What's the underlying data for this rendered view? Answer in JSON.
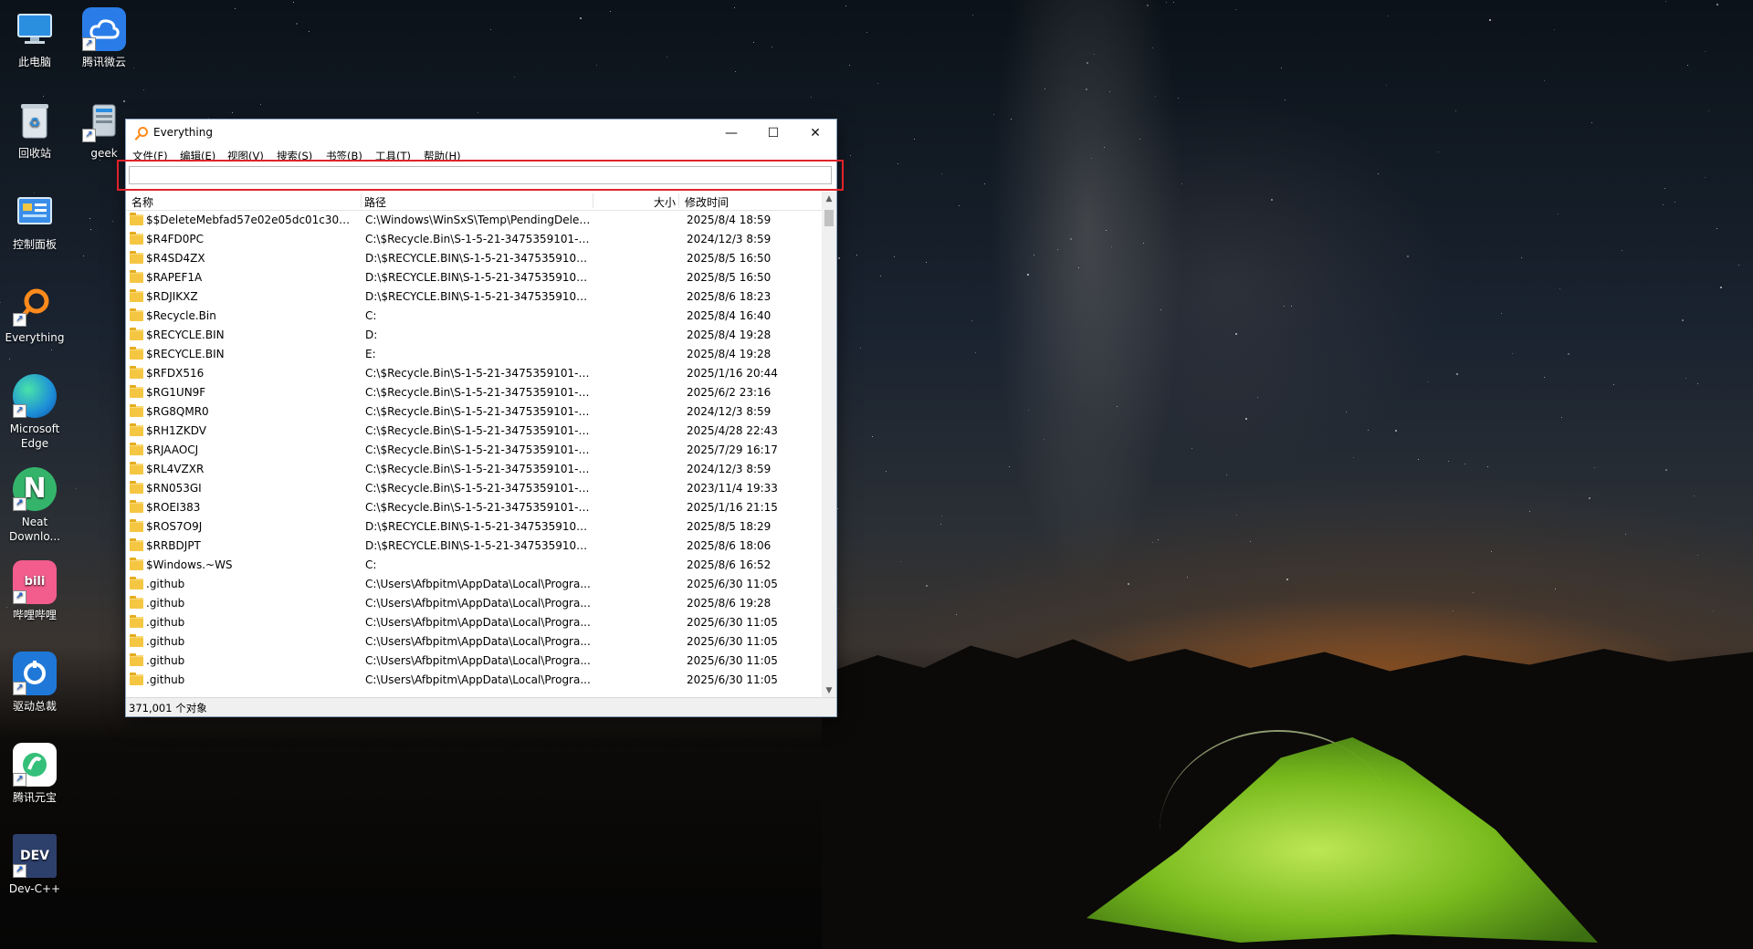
{
  "desktop": {
    "icons": [
      {
        "label": "此电脑",
        "icon": "computer-icon"
      },
      {
        "label": "腾讯微云",
        "icon": "cloud-icon"
      },
      {
        "label": "回收站",
        "icon": "recycle-bin-icon"
      },
      {
        "label": "geek",
        "icon": "geek-app-icon"
      },
      {
        "label": "控制面板",
        "icon": "control-panel-icon"
      },
      {
        "label": "Everything",
        "icon": "everything-icon"
      },
      {
        "label": "Microsoft Edge",
        "icon": "edge-icon"
      },
      {
        "label": "Neat Downlo...",
        "icon": "neat-download-icon"
      },
      {
        "label": "哔哩哔哩",
        "icon": "bilibili-icon"
      },
      {
        "label": "驱动总裁",
        "icon": "driver-icon"
      },
      {
        "label": "腾讯元宝",
        "icon": "yuanbao-icon"
      },
      {
        "label": "Dev-C++",
        "icon": "devcpp-icon"
      }
    ]
  },
  "window": {
    "title": "Everything",
    "controls": {
      "minimize": "—",
      "maximize": "☐",
      "close": "✕"
    },
    "menu": [
      "文件(F)",
      "编辑(E)",
      "视图(V)",
      "搜索(S)",
      "书签(B)",
      "工具(T)",
      "帮助(H)"
    ],
    "search": {
      "value": "",
      "placeholder": ""
    },
    "columns": {
      "name": "名称",
      "path": "路径",
      "size": "大小",
      "modified": "修改时间"
    },
    "rows": [
      {
        "name": "$$DeleteMebfad57e02e05dc01c30000...",
        "path": "C:\\Windows\\WinSxS\\Temp\\PendingDelet...",
        "modified": "2025/8/4 18:59"
      },
      {
        "name": "$R4FD0PC",
        "path": "C:\\$Recycle.Bin\\S-1-5-21-3475359101-10...",
        "modified": "2024/12/3 8:59"
      },
      {
        "name": "$R4SD4ZX",
        "path": "D:\\$RECYCLE.BIN\\S-1-5-21-3475359101-...",
        "modified": "2025/8/5 16:50"
      },
      {
        "name": "$RAPEF1A",
        "path": "D:\\$RECYCLE.BIN\\S-1-5-21-3475359101-...",
        "modified": "2025/8/5 16:50"
      },
      {
        "name": "$RDJIKXZ",
        "path": "D:\\$RECYCLE.BIN\\S-1-5-21-3475359101-...",
        "modified": "2025/8/6 18:23"
      },
      {
        "name": "$Recycle.Bin",
        "path": "C:",
        "modified": "2025/8/4 16:40"
      },
      {
        "name": "$RECYCLE.BIN",
        "path": "D:",
        "modified": "2025/8/4 19:28"
      },
      {
        "name": "$RECYCLE.BIN",
        "path": "E:",
        "modified": "2025/8/4 19:28"
      },
      {
        "name": "$RFDX516",
        "path": "C:\\$Recycle.Bin\\S-1-5-21-3475359101-10...",
        "modified": "2025/1/16 20:44"
      },
      {
        "name": "$RG1UN9F",
        "path": "C:\\$Recycle.Bin\\S-1-5-21-3475359101-10...",
        "modified": "2025/6/2 23:16"
      },
      {
        "name": "$RG8QMR0",
        "path": "C:\\$Recycle.Bin\\S-1-5-21-3475359101-10...",
        "modified": "2024/12/3 8:59"
      },
      {
        "name": "$RH1ZKDV",
        "path": "C:\\$Recycle.Bin\\S-1-5-21-3475359101-10...",
        "modified": "2025/4/28 22:43"
      },
      {
        "name": "$RJAAOCJ",
        "path": "C:\\$Recycle.Bin\\S-1-5-21-3475359101-10...",
        "modified": "2025/7/29 16:17"
      },
      {
        "name": "$RL4VZXR",
        "path": "C:\\$Recycle.Bin\\S-1-5-21-3475359101-10...",
        "modified": "2024/12/3 8:59"
      },
      {
        "name": "$RN053GI",
        "path": "C:\\$Recycle.Bin\\S-1-5-21-3475359101-10...",
        "modified": "2023/11/4 19:33"
      },
      {
        "name": "$ROEI383",
        "path": "C:\\$Recycle.Bin\\S-1-5-21-3475359101-10...",
        "modified": "2025/1/16 21:15"
      },
      {
        "name": "$ROS7O9J",
        "path": "D:\\$RECYCLE.BIN\\S-1-5-21-3475359101-...",
        "modified": "2025/8/5 18:29"
      },
      {
        "name": "$RRBDJPT",
        "path": "D:\\$RECYCLE.BIN\\S-1-5-21-3475359101-...",
        "modified": "2025/8/6 18:06"
      },
      {
        "name": "$Windows.~WS",
        "path": "C:",
        "modified": "2025/8/6 16:52"
      },
      {
        "name": ".github",
        "path": "C:\\Users\\Afbpitm\\AppData\\Local\\Progra...",
        "modified": "2025/6/30 11:05"
      },
      {
        "name": ".github",
        "path": "C:\\Users\\Afbpitm\\AppData\\Local\\Progra...",
        "modified": "2025/8/6 19:28"
      },
      {
        "name": ".github",
        "path": "C:\\Users\\Afbpitm\\AppData\\Local\\Progra...",
        "modified": "2025/6/30 11:05"
      },
      {
        "name": ".github",
        "path": "C:\\Users\\Afbpitm\\AppData\\Local\\Progra...",
        "modified": "2025/6/30 11:05"
      },
      {
        "name": ".github",
        "path": "C:\\Users\\Afbpitm\\AppData\\Local\\Progra...",
        "modified": "2025/6/30 11:05"
      },
      {
        "name": ".github",
        "path": "C:\\Users\\Afbpitm\\AppData\\Local\\Progra...",
        "modified": "2025/6/30 11:05"
      }
    ],
    "status": "371,001 个对象"
  }
}
